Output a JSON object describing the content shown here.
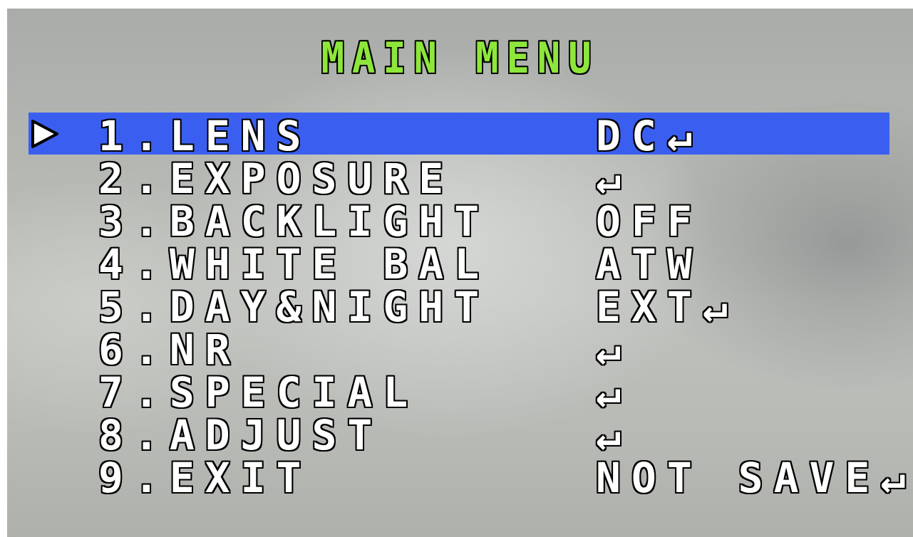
{
  "osd": {
    "title": "MAIN MENU",
    "colors": {
      "title": "#8ee63b",
      "text": "#ffffff",
      "outline": "#000000",
      "highlight": "#3a5ff0"
    },
    "cursor_icon": "triangle-right-icon",
    "selected_index": 0,
    "items": [
      {
        "label": "1.LENS",
        "value": "DC↵"
      },
      {
        "label": "2.EXPOSURE",
        "value": "↵"
      },
      {
        "label": "3.BACKLIGHT",
        "value": "OFF"
      },
      {
        "label": "4.WHITE BAL",
        "value": "ATW"
      },
      {
        "label": "5.DAY&NIGHT",
        "value": "EXT↵"
      },
      {
        "label": "6.NR",
        "value": "↵"
      },
      {
        "label": "7.SPECIAL",
        "value": "↵"
      },
      {
        "label": "8.ADJUST",
        "value": "↵"
      },
      {
        "label": "9.EXIT",
        "value": "NOT SAVE↵"
      }
    ]
  }
}
